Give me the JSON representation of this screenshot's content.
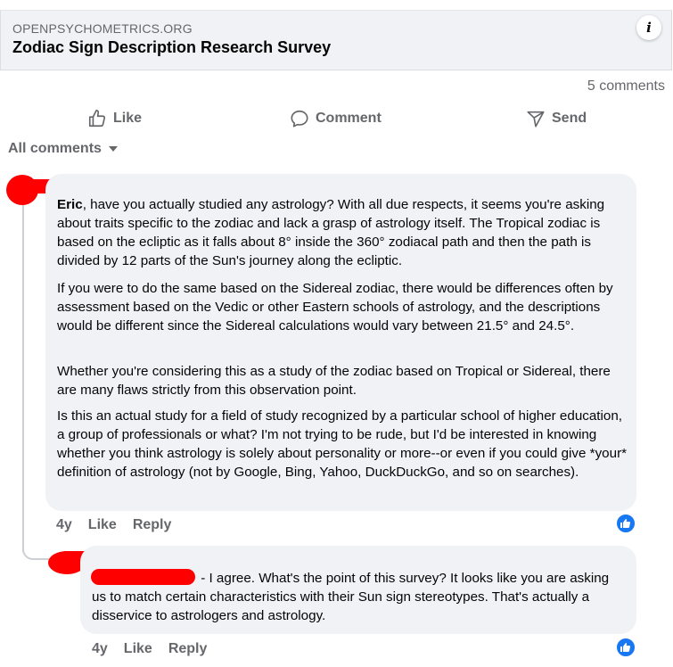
{
  "link_card": {
    "domain": "OPENPSYCHOMETRICS.ORG",
    "title": "Zodiac Sign Description Research Survey",
    "info_glyph": "i"
  },
  "comment_count": "5 comments",
  "actions": {
    "like": "Like",
    "comment": "Comment",
    "send": "Send"
  },
  "filter": {
    "label": "All comments"
  },
  "comments": [
    {
      "mention": "Eric",
      "paragraphs": [
        ", have you actually studied any astrology? With all due respects, it seems you're asking about traits specific to the zodiac and lack a grasp of astrology itself. The Tropical zodiac is based on the ecliptic as it falls about 8° inside the 360° zodiacal path and then the path is divided by 12 parts of the Sun's journey along the ecliptic.",
        "If you were to do the same based on the Sidereal zodiac, there would be differences often by assessment based on the Vedic or other Eastern schools of astrology, and the descriptions would be different since the Sidereal calculations would vary between 21.5° and 24.5°.",
        "Whether you're considering this as a study of the zodiac based on Tropical or Sidereal, there are many flaws strictly from this observation point.",
        "Is this an actual study for a field of study recognized by a particular school of higher education, a group of professionals or what? I'm not trying to be rude, but I'd be interested in knowing whether you think astrology is solely about personality or more--or even if you could give *your* definition of astrology (not by Google, Bing, Yahoo, DuckDuckGo, and so on searches)."
      ],
      "age": "4y",
      "like_label": "Like",
      "reply_label": "Reply",
      "reaction": "like"
    },
    {
      "text": " - I agree. What's the point of this survey? It looks like you are asking us to match certain characteristics with their Sun sign stereotypes. That's actually a disservice to astrologers and astrology.",
      "age": "4y",
      "like_label": "Like",
      "reply_label": "Reply",
      "reaction": "like"
    }
  ],
  "icons": {
    "info": "info-icon",
    "like": "thumbs-up-icon",
    "comment": "comment-icon",
    "send": "send-icon",
    "filter_caret": "caret-down-icon",
    "reaction": "like-reaction-icon"
  },
  "colors": {
    "redaction": "#ff0000",
    "bubble": "#f0f2f5",
    "secondary_text": "#65676b",
    "reaction_blue": "#1877f2"
  }
}
